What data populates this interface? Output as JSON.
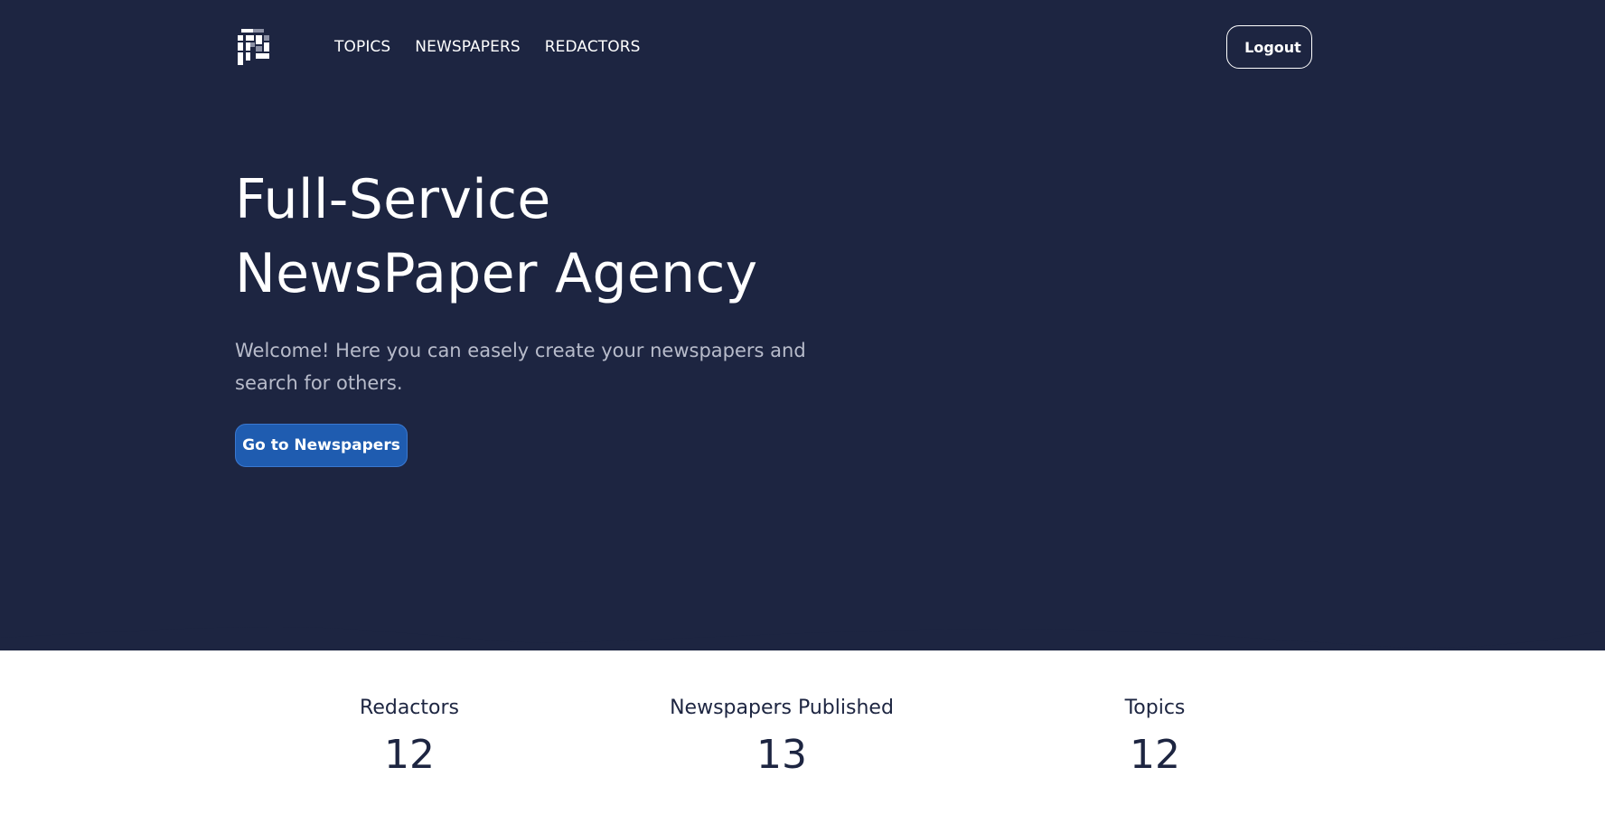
{
  "nav": {
    "items": [
      {
        "label": "TOPICS"
      },
      {
        "label": "NEWSPAPERS"
      },
      {
        "label": "REDACTORS"
      }
    ],
    "logout_label": "Logout"
  },
  "hero": {
    "title_line1": "Full-Service",
    "title_line2": "NewsPaper Agency",
    "subtitle_line1": "Welcome! Here you can easely create your newspapers and",
    "subtitle_line2": "search for others.",
    "cta_label": "Go to Newspapers"
  },
  "stats": [
    {
      "label": "Redactors",
      "value": "12"
    },
    {
      "label": "Newspapers Published",
      "value": "13"
    },
    {
      "label": "Topics",
      "value": "12"
    }
  ],
  "colors": {
    "hero_background": "#1d2541",
    "accent": "#1f5cb0",
    "text_dark": "#1d2541"
  },
  "icons": {
    "logo": "brand-logo-icon"
  }
}
